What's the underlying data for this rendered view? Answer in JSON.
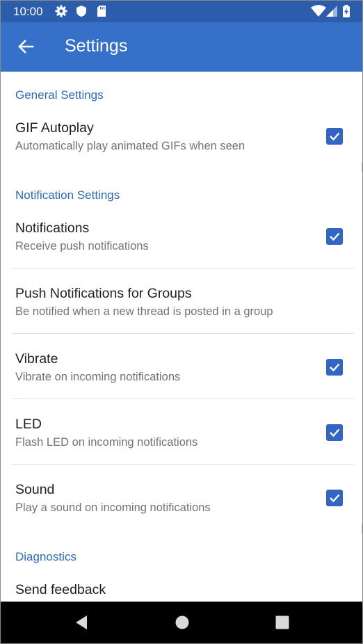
{
  "status_bar": {
    "time": "10:00"
  },
  "app_bar": {
    "title": "Settings"
  },
  "sections": {
    "general": {
      "header": "General Settings"
    },
    "notification": {
      "header": "Notification Settings"
    },
    "diagnostics": {
      "header": "Diagnostics"
    }
  },
  "prefs": {
    "gif_autoplay": {
      "title": "GIF Autoplay",
      "summary": "Automatically play animated GIFs when seen",
      "checked": true
    },
    "notifications": {
      "title": "Notifications",
      "summary": "Receive push notifications",
      "checked": true
    },
    "push_groups": {
      "title": "Push Notifications for Groups",
      "summary": "Be notified when a new thread is posted in a group"
    },
    "vibrate": {
      "title": "Vibrate",
      "summary": "Vibrate on incoming notifications",
      "checked": true
    },
    "led": {
      "title": "LED",
      "summary": "Flash LED on incoming notifications",
      "checked": true
    },
    "sound": {
      "title": "Sound",
      "summary": "Play a sound on incoming notifications",
      "checked": true
    },
    "send_feedback": {
      "title": "Send feedback"
    }
  },
  "colors": {
    "status_bar": "#2b5dac",
    "app_bar": "#3670c8",
    "accent": "#3266c2",
    "section_header": "#2f69b8"
  },
  "icons": {
    "status": [
      "gear-icon",
      "shield-icon",
      "sd-card-icon",
      "wifi-icon",
      "signal-icon",
      "battery-charging-icon"
    ],
    "nav": [
      "back-triangle-icon",
      "home-circle-icon",
      "recents-square-icon"
    ]
  }
}
